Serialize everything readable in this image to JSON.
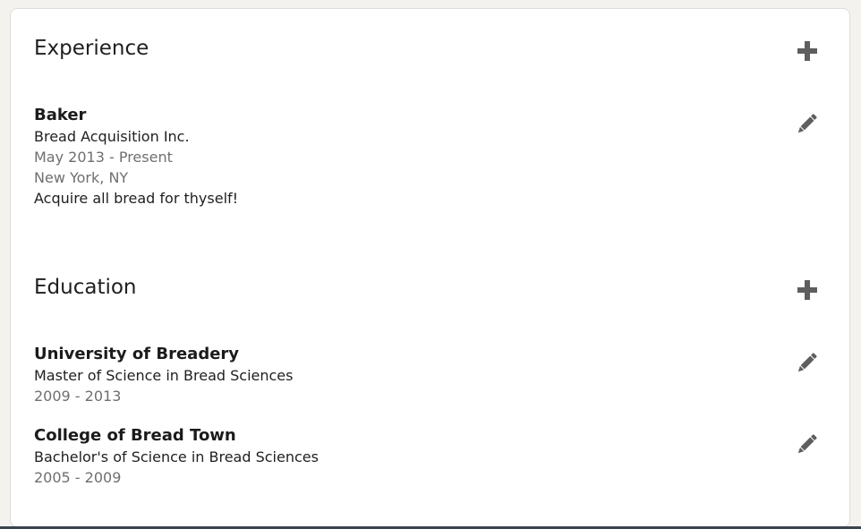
{
  "experience": {
    "heading": "Experience",
    "add_icon": "plus-icon",
    "items": [
      {
        "title": "Baker",
        "company": "Bread Acquisition Inc.",
        "dates": "May 2013 - Present",
        "location": "New York, NY",
        "description": "Acquire all bread for thyself!",
        "edit_icon": "pencil-icon"
      }
    ]
  },
  "education": {
    "heading": "Education",
    "add_icon": "plus-icon",
    "items": [
      {
        "school": "University of Breadery",
        "degree": "Master of Science in Bread Sciences",
        "years": "2009 - 2013",
        "edit_icon": "pencil-icon"
      },
      {
        "school": "College of Bread Town",
        "degree": "Bachelor's of Science in Bread Sciences",
        "years": "2005 - 2009",
        "edit_icon": "pencil-icon"
      }
    ]
  },
  "colors": {
    "icon": "#5e5e5e",
    "muted_text": "#6f6f6f",
    "card_bg": "#ffffff",
    "page_bg": "#f3f2ef"
  }
}
